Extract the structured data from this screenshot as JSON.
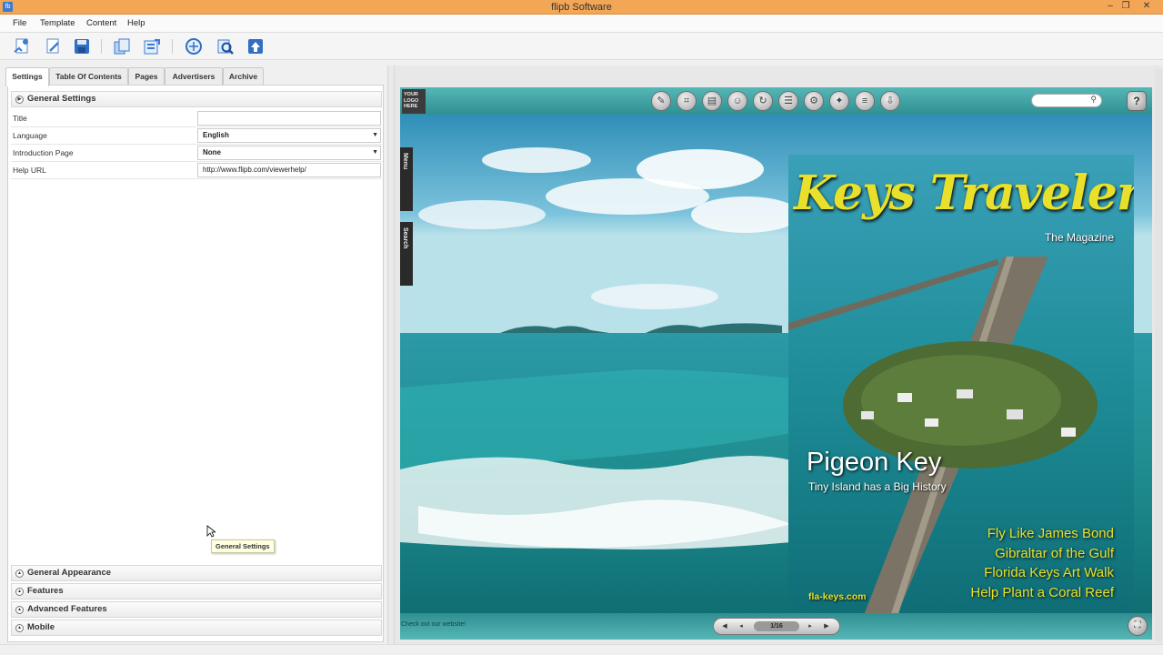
{
  "window": {
    "title": "flipb Software",
    "minimize": "‒",
    "restore": "❐",
    "close": "✕"
  },
  "menu": [
    "File",
    "Template",
    "Content",
    "Help"
  ],
  "tabs": [
    "Settings",
    "Table Of Contents",
    "Pages",
    "Advertisers",
    "Archive"
  ],
  "settings": {
    "general_header": "General Settings",
    "rows": [
      {
        "label": "Title",
        "value": ""
      },
      {
        "label": "Language",
        "value": "English"
      },
      {
        "label": "Introduction Page",
        "value": "None"
      },
      {
        "label": "Help URL",
        "value": "http://www.flipb.com/viewerhelp/"
      }
    ],
    "sections": [
      "General Appearance",
      "Features",
      "Advanced Features",
      "Mobile"
    ],
    "tooltip": "General Settings"
  },
  "viewer": {
    "logo_text": "YOUR LOGO HERE",
    "side_tabs": [
      "Menu",
      "Search"
    ],
    "cover": {
      "title": "Keys Traveler",
      "subtitle": "The Magazine",
      "headline": "Pigeon Key",
      "subheadline": "Tiny Island has a Big History",
      "website": "fla-keys.com",
      "features": [
        "Fly Like James Bond",
        "Gibraltar of the Gulf",
        "Florida Keys Art Walk",
        "Help Plant a Coral Reef"
      ]
    },
    "footer_message": "Check out our website!",
    "page_indicator": "1/16",
    "help_label": "?"
  },
  "colors": {
    "titlebar": "#f2a656",
    "viewer_frame": "#3c9ea0",
    "cover_accent": "#e8e02a"
  }
}
